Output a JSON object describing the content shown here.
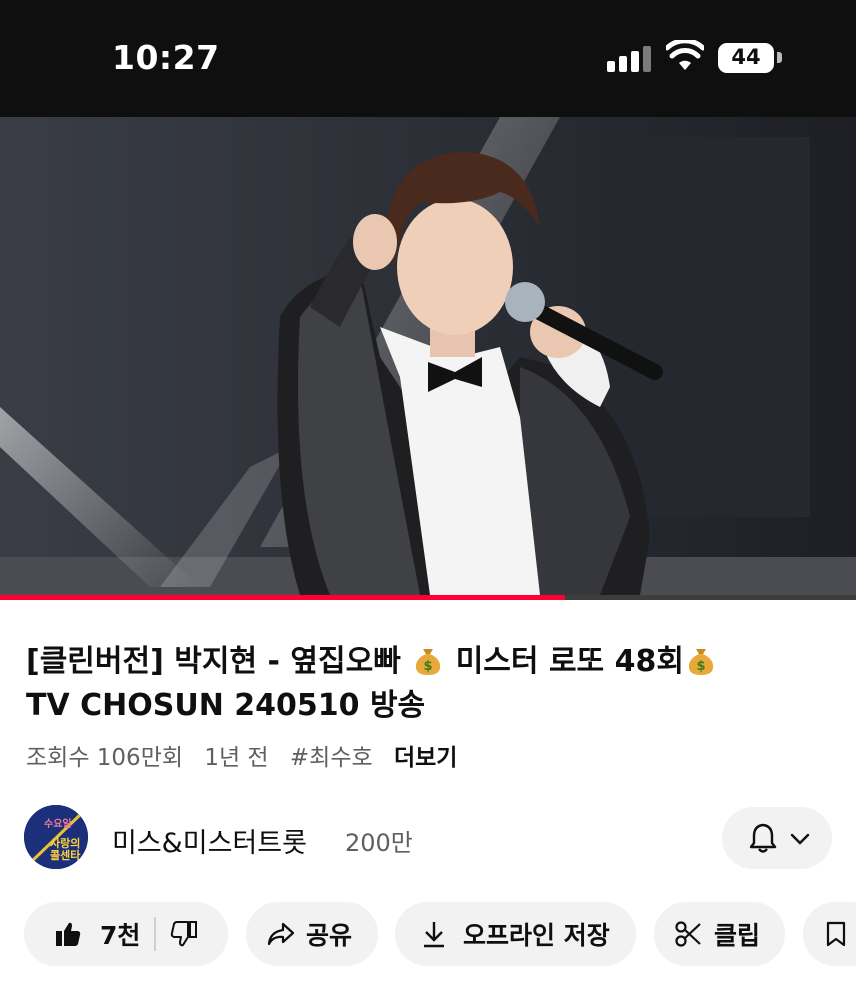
{
  "status_bar": {
    "time": "10:27",
    "battery": "44"
  },
  "video": {
    "progress": 0.66
  },
  "title": {
    "line1_part1": "[클린버전] 박지현 - 옆집오빠 ",
    "line1_part2": " 미스터 로또 48회",
    "line2": "TV CHOSUN 240510 방송"
  },
  "meta": {
    "views": "조회수 106만회",
    "age": "1년 전",
    "hashtag": "#최수호",
    "more": "더보기"
  },
  "channel": {
    "name": "미스&미스터트롯",
    "subscribers": "200만",
    "avatar_text": [
      "수요일",
      "사랑의",
      "콜센타"
    ]
  },
  "actions": {
    "likes": "7천",
    "share": "공유",
    "download": "오프라인 저장",
    "clip": "클립"
  },
  "icons": [
    "signal-icon",
    "wifi-icon",
    "battery-icon",
    "money-bag-icon",
    "like-icon",
    "dislike-icon",
    "share-icon",
    "download-icon",
    "scissors-icon",
    "bell-icon",
    "chevron-down-icon",
    "bookmark-icon"
  ],
  "colors": {
    "progress": "#ff0033",
    "status_bar": "#0f0f0f",
    "pill_bg": "#f2f2f2"
  }
}
